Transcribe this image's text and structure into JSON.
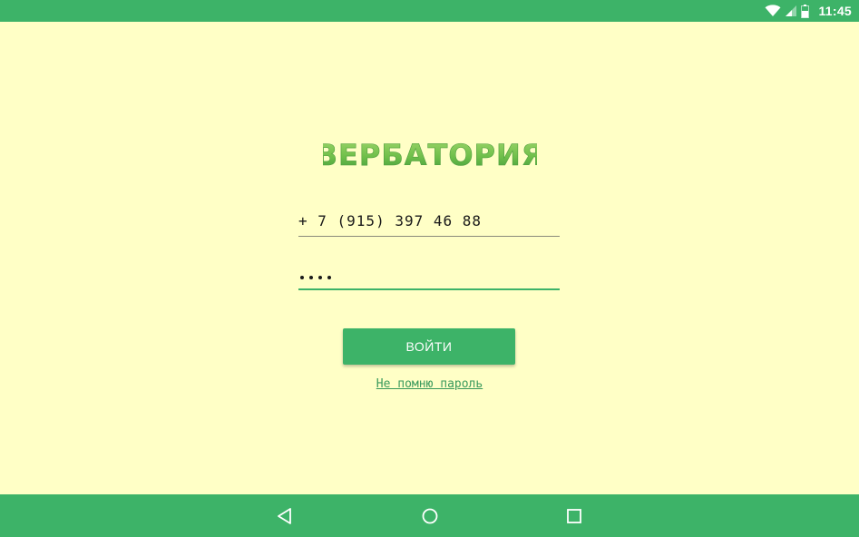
{
  "status_bar": {
    "time": "11:45",
    "icons": [
      "wifi-icon",
      "signal-icon",
      "battery-icon"
    ]
  },
  "app": {
    "logo_text": "ВЕРБАТОРИЯ"
  },
  "login_form": {
    "phone_value": "+ 7 (915) 397 46 88",
    "password_masked_length": 4,
    "login_button_label": "ВОЙТИ",
    "forgot_password_link": "Не помню пароль"
  },
  "nav_bar": {
    "buttons": [
      "back-icon",
      "home-icon",
      "recents-icon"
    ]
  },
  "colors": {
    "background": "#ffffc6",
    "accent": "#3db368",
    "link": "#3a9a5c"
  }
}
